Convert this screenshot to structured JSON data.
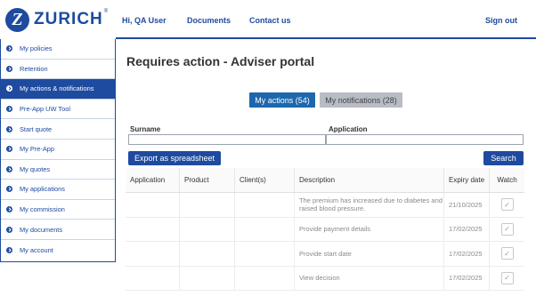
{
  "header": {
    "logo_text": "ZURICH",
    "logo_letter": "Z",
    "logo_mark": "®",
    "greeting": "Hi, QA User",
    "documents": "Documents",
    "contact": "Contact us",
    "signout": "Sign out"
  },
  "sidebar": {
    "items": [
      {
        "label": "My policies"
      },
      {
        "label": "Retention"
      },
      {
        "label": "My actions & notifications"
      },
      {
        "label": "Pre-App UW Tool"
      },
      {
        "label": "Start quote"
      },
      {
        "label": "My Pre-App"
      },
      {
        "label": "My quotes"
      },
      {
        "label": "My applications"
      },
      {
        "label": "My commission"
      },
      {
        "label": "My documents"
      },
      {
        "label": "My account"
      }
    ],
    "active_index": 2
  },
  "main": {
    "title": "Requires action - Adviser portal",
    "tabs": {
      "actions": "My actions (54)",
      "notifications": "My notifications (28)"
    },
    "search": {
      "surname_label": "Surname",
      "application_label": "Application",
      "export_button": "Export as spreadsheet",
      "search_button": "Search"
    },
    "table": {
      "headers": [
        "Application",
        "Product",
        "Client(s)",
        "Description",
        "Expiry date",
        "Watch"
      ],
      "rows": [
        {
          "description": "The premium has increased due to diabetes and raised blood pressure.",
          "expiry": "21/10/2025",
          "watch": "✓"
        },
        {
          "description": "Provide payment details",
          "expiry": "17/02/2025",
          "watch": "✓"
        },
        {
          "description": "Provide start date",
          "expiry": "17/02/2025",
          "watch": "✓"
        },
        {
          "description": "View decision",
          "expiry": "17/02/2025",
          "watch": "✓"
        }
      ]
    }
  },
  "colors": {
    "brand": "#1e4ba0",
    "tab_active": "#1d67ad",
    "tab_inactive": "#b8bcc4"
  }
}
